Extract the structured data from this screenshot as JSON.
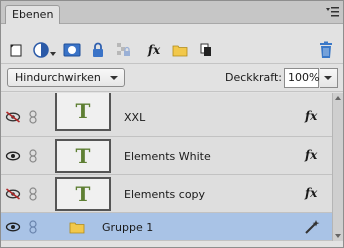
{
  "tab": {
    "label": "Ebenen"
  },
  "toolbar": {
    "icons": [
      "new-layer-icon",
      "adjustment-layer-icon",
      "layer-mask-icon",
      "lock-icon",
      "lock-transparent-icon",
      "fx-icon",
      "new-group-icon",
      "link-icon",
      "delete-layer-icon"
    ],
    "fx_label": "fx"
  },
  "blend": {
    "selected": "Hindurchwirken"
  },
  "opacity": {
    "label": "Deckkraft:",
    "value": "100%"
  },
  "layers": [
    {
      "name": "XXL",
      "visible": false,
      "thumb_text": "T",
      "fx_label": "fx"
    },
    {
      "name": "Elements White",
      "visible": true,
      "thumb_text": "T",
      "fx_label": "fx"
    },
    {
      "name": "Elements copy",
      "visible": false,
      "thumb_text": "T",
      "fx_label": "fx"
    },
    {
      "name": "Gruppe 1",
      "visible": true,
      "selected": true,
      "type": "group"
    }
  ],
  "colors": {
    "selected_row": "#a9c3e6",
    "text_thumb": "#5e7f33",
    "folder": "#f2c84b",
    "delete": "#3a78c8"
  }
}
